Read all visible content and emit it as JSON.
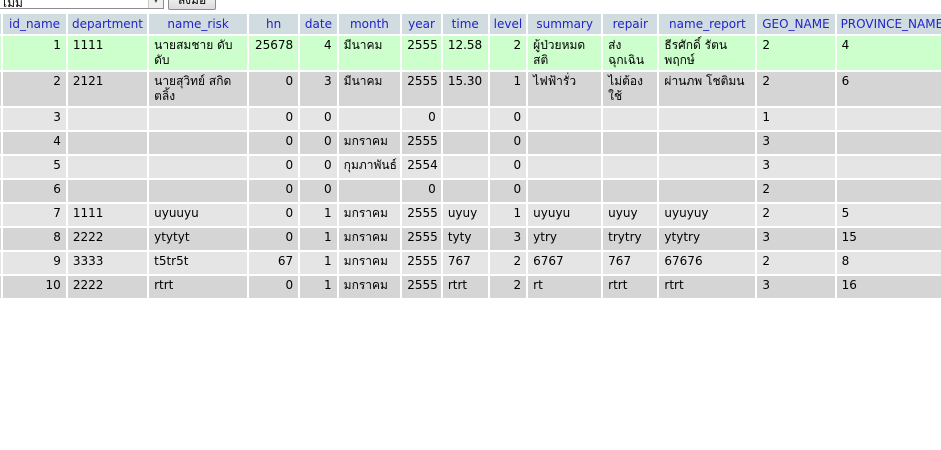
{
  "toolbar": {
    "select_value": "เมม",
    "go_label": "ลงมือ"
  },
  "table": {
    "columns": [
      "id_name",
      "department",
      "name_risk",
      "hn",
      "date",
      "month",
      "year",
      "time",
      "level",
      "summary",
      "repair",
      "name_report",
      "GEO_NAME",
      "PROVINCE_NAME"
    ],
    "rows": [
      {
        "id_name": "1",
        "department": "1111",
        "name_risk": "นายสมชาย ดับดับ",
        "hn": "25678",
        "date": "4",
        "month": "มีนาคม",
        "year": "2555",
        "time": "12.58",
        "level": "2",
        "summary": "ผู้ป่วยหมดสติ",
        "repair": "ส่งฉุกเฉิน",
        "name_report": "ธีรศักดิ์ รัตนพฤกษ์",
        "geo_name": "2",
        "province_name": "4"
      },
      {
        "id_name": "2",
        "department": "2121",
        "name_risk": "นายสุวิทย์ สกิดตลิ้ง",
        "hn": "0",
        "date": "3",
        "month": "มีนาคม",
        "year": "2555",
        "time": "15.30",
        "level": "1",
        "summary": "ไฟฟ้ารั่ว",
        "repair": "ไม่ต้องใช้",
        "name_report": "ผ่านภพ โชติมน",
        "geo_name": "2",
        "province_name": "6"
      },
      {
        "id_name": "3",
        "department": "",
        "name_risk": "",
        "hn": "0",
        "date": "0",
        "month": "",
        "year": "0",
        "time": "",
        "level": "0",
        "summary": "",
        "repair": "",
        "name_report": "",
        "geo_name": "1",
        "province_name": ""
      },
      {
        "id_name": "4",
        "department": "",
        "name_risk": "",
        "hn": "0",
        "date": "0",
        "month": "มกราคม",
        "year": "2555",
        "time": "",
        "level": "0",
        "summary": "",
        "repair": "",
        "name_report": "",
        "geo_name": "3",
        "province_name": ""
      },
      {
        "id_name": "5",
        "department": "",
        "name_risk": "",
        "hn": "0",
        "date": "0",
        "month": "กุมภาพันธ์",
        "year": "2554",
        "time": "",
        "level": "0",
        "summary": "",
        "repair": "",
        "name_report": "",
        "geo_name": "3",
        "province_name": ""
      },
      {
        "id_name": "6",
        "department": "",
        "name_risk": "",
        "hn": "0",
        "date": "0",
        "month": "",
        "year": "0",
        "time": "",
        "level": "0",
        "summary": "",
        "repair": "",
        "name_report": "",
        "geo_name": "2",
        "province_name": ""
      },
      {
        "id_name": "7",
        "department": "1111",
        "name_risk": "uyuuyu",
        "hn": "0",
        "date": "1",
        "month": "มกราคม",
        "year": "2555",
        "time": "uyuy",
        "level": "1",
        "summary": "uyuyu",
        "repair": "uyuy",
        "name_report": "uyuyuy",
        "geo_name": "2",
        "province_name": "5"
      },
      {
        "id_name": "8",
        "department": "2222",
        "name_risk": "ytytyt",
        "hn": "0",
        "date": "1",
        "month": "มกราคม",
        "year": "2555",
        "time": "tyty",
        "level": "3",
        "summary": "ytry",
        "repair": "trytry",
        "name_report": "ytytry",
        "geo_name": "3",
        "province_name": "15"
      },
      {
        "id_name": "9",
        "department": "3333",
        "name_risk": "t5tr5t",
        "hn": "67",
        "date": "1",
        "month": "มกราคม",
        "year": "2555",
        "time": "767",
        "level": "2",
        "summary": "6767",
        "repair": "767",
        "name_report": "67676",
        "geo_name": "2",
        "province_name": "8"
      },
      {
        "id_name": "10",
        "department": "2222",
        "name_risk": "rtrt",
        "hn": "0",
        "date": "1",
        "month": "มกราคม",
        "year": "2555",
        "time": "rtrt",
        "level": "2",
        "summary": "rt",
        "repair": "rtrt",
        "name_report": "rtrt",
        "geo_name": "3",
        "province_name": "16"
      }
    ]
  }
}
